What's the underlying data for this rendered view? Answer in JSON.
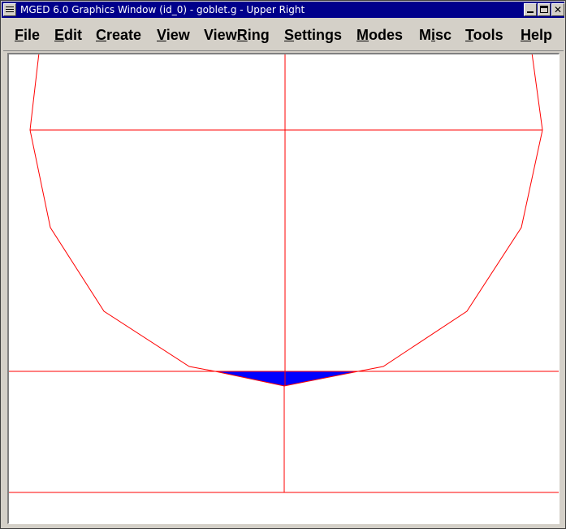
{
  "window": {
    "title": "MGED 6.0 Graphics Window (id_0) - goblet.g - Upper Right"
  },
  "menu": [
    {
      "first": "F",
      "rest": "ile"
    },
    {
      "first": "E",
      "rest": "dit"
    },
    {
      "first": "C",
      "rest": "reate"
    },
    {
      "first": "V",
      "rest": "iew"
    },
    {
      "pre": "View",
      "first": "R",
      "rest": "ing"
    },
    {
      "first": "S",
      "rest": "ettings"
    },
    {
      "first": "M",
      "rest": "odes"
    },
    {
      "pre": "M",
      "first": "i",
      "rest": "sc"
    },
    {
      "first": "T",
      "rest": "ools"
    },
    {
      "first": "H",
      "rest": "elp"
    }
  ],
  "colors": {
    "wireframe": "#ff0000",
    "highlight": "#0000ff",
    "canvas": "#ffffff"
  }
}
